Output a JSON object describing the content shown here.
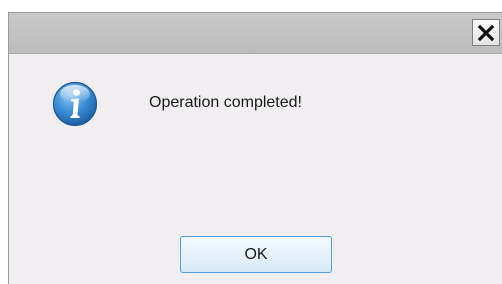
{
  "dialog": {
    "close_icon": "close-icon",
    "icon": "info-icon",
    "message": "Operation completed!",
    "ok_label": "OK"
  },
  "colors": {
    "titlebar": "#c4c4c4",
    "body": "#f0eef0",
    "button_border": "#4f9fd8",
    "icon_blue": "#2a7cc7"
  }
}
